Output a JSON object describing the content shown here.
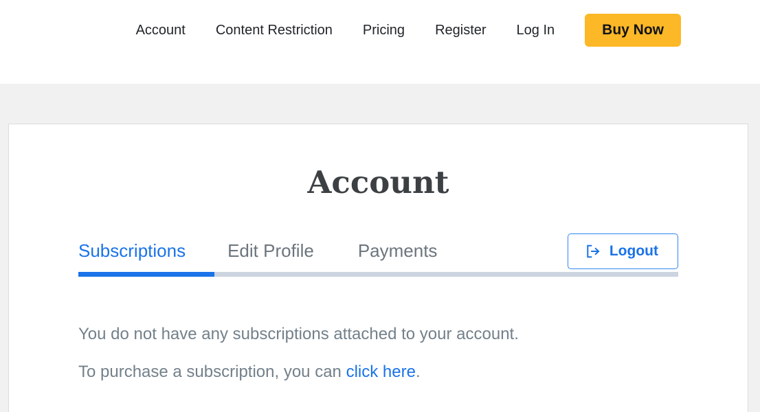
{
  "colors": {
    "accent_blue": "#1a73e8",
    "buy_button_bg": "#FDB827",
    "page_bg": "#f1f1f1",
    "card_bg": "#ffffff",
    "muted_text": "#73808a",
    "inactive_tab": "#6c757d",
    "card_border": "#dcdcdc",
    "tab_bar": "#ccd4e0"
  },
  "nav": {
    "items": [
      {
        "label": "Account"
      },
      {
        "label": "Content Restriction"
      },
      {
        "label": "Pricing"
      },
      {
        "label": "Register"
      },
      {
        "label": "Log In"
      }
    ],
    "cta": {
      "label": "Buy Now"
    }
  },
  "page": {
    "title": "Account"
  },
  "tabs": {
    "items": [
      {
        "label": "Subscriptions",
        "active": true
      },
      {
        "label": "Edit Profile",
        "active": false
      },
      {
        "label": "Payments",
        "active": false
      }
    ],
    "logout": {
      "label": "Logout",
      "icon": "sign-out-icon"
    }
  },
  "content": {
    "line1": "You do not have any subscriptions attached to your account.",
    "line2_prefix": "To purchase a subscription, you can ",
    "line2_link": "click here",
    "line2_suffix": "."
  }
}
